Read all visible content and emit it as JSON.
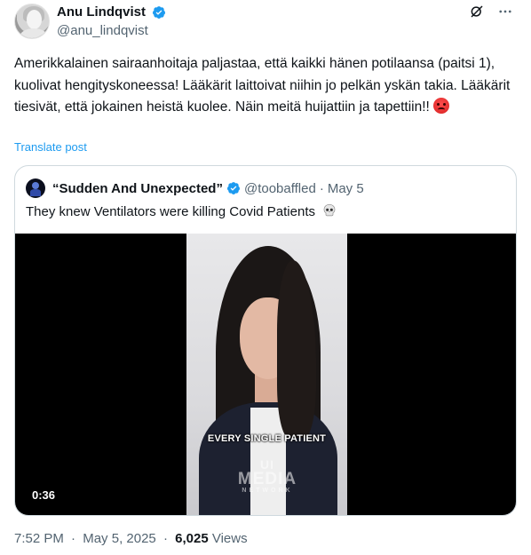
{
  "author": {
    "display_name": "Anu Lindqvist",
    "handle": "@anu_lindqvist",
    "verified_icon": "verified-badge-icon"
  },
  "header_actions": {
    "grok_icon": "grok-icon",
    "more_icon": "more-dots-icon",
    "more_label": "···"
  },
  "post": {
    "text": "Amerikkalainen sairaanhoitaja paljastaa, että kaikki hänen potilaansa (paitsi 1), kuolivat hengityskoneessa! Lääkärit laittoivat niihin jo pelkän yskän takia. Lääkärit tiesivät, että jokainen heistä kuolee. Näin meitä huijattiin ja tapettiin!!",
    "trailing_emoji": "angry-face-emoji",
    "translate_label": "Translate post"
  },
  "quoted_post": {
    "display_name": "“Sudden And Unexpected”",
    "handle": "@toobaffled",
    "dot": "·",
    "date": "May 5",
    "text": "They knew Ventilators were killing Covid Patients",
    "emoji": "skull-emoji",
    "video": {
      "caption": "EVERY SINGLE PATIENT",
      "watermark_top": "UI",
      "watermark_main": "MEDIA",
      "watermark_sub": "NETWORK",
      "duration": "0:36"
    }
  },
  "meta": {
    "time": "7:52 PM",
    "sep": "·",
    "date": "May 5, 2025",
    "views_count": "6,025",
    "views_label": "Views"
  },
  "colors": {
    "accent": "#1d9bf0",
    "text_primary": "#0f1419",
    "text_secondary": "#536471",
    "border": "#cfd9de"
  }
}
